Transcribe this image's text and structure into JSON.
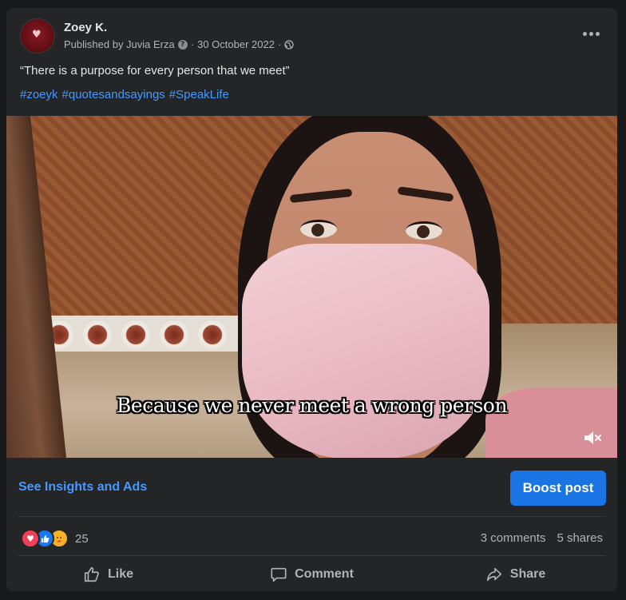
{
  "post": {
    "author": "Zoey K.",
    "published_by": "Published by Juvia Erza",
    "separator": "·",
    "date": "30 October 2022",
    "caption": "“There is a purpose for every person that we meet”",
    "hashtags": [
      "#zoeyk",
      "#quotesandsayings",
      "#SpeakLife"
    ]
  },
  "video": {
    "subtitle": "Because we never meet a wrong person",
    "mute_icon": "speaker-muted-icon"
  },
  "promo": {
    "insights_label": "See Insights and Ads",
    "boost_label": "Boost post"
  },
  "stats": {
    "reaction_icons": [
      "love-icon",
      "like-icon",
      "care-icon"
    ],
    "reaction_count": "25",
    "comments": "3 comments",
    "shares": "5 shares"
  },
  "actions": {
    "like": "Like",
    "comment": "Comment",
    "share": "Share"
  },
  "colors": {
    "background": "#18191a",
    "card": "#242526",
    "link": "#4599ff",
    "boost": "#1b74e4",
    "secondary_text": "#b0b3b8"
  }
}
